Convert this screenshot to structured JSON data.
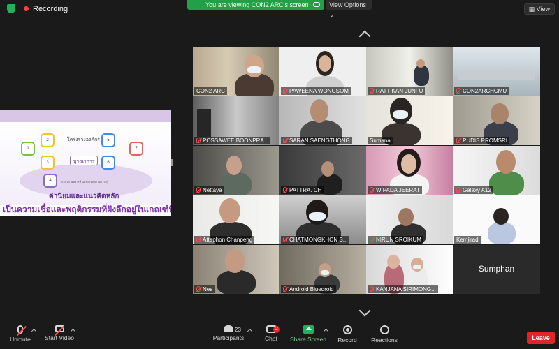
{
  "status": {
    "recording_label": "Recording"
  },
  "banner": {
    "viewing_text": "You are viewing CON2 ARC's screen",
    "view_options_label": "View Options"
  },
  "view_button": {
    "label": "View"
  },
  "shared_screen": {
    "top_hex_label": "โครงร่างองค์กร",
    "center_label": "บูรณาการ",
    "core_values_label": "ค่านิยมและแนวคิดหลัก",
    "bottom_text": "เป็นความเชื่อและพฤติกรรมที่ฝังลึกอยู่ในเกณฑ์นี้ แ",
    "hex_numbers": [
      "1",
      "2",
      "3",
      "4",
      "5",
      "6",
      "7"
    ],
    "hex_labels": [
      "การนำองค์กร",
      "กลยุทธ์",
      "ลูกค้า",
      "การวัด",
      "บุคลากร",
      "ระบบปฏิบัติการ",
      "ผลลัพธ์"
    ],
    "small_caption": "การวัด วิเคราะห์ และการจัดการความรู้"
  },
  "participants": [
    {
      "name": "CON2 ARC",
      "muted": false,
      "active": true
    },
    {
      "name": "PAWEENA WONGSOM",
      "muted": true
    },
    {
      "name": "RATTIKAN JUNFU",
      "muted": true
    },
    {
      "name": "CON2ARCHCMU",
      "muted": true
    },
    {
      "name": "POSSAWEE BOONPRA...",
      "muted": true
    },
    {
      "name": "SARAN SAENGTHONG",
      "muted": true
    },
    {
      "name": "Sumana",
      "muted": false
    },
    {
      "name": "PUDIS PROMSRI",
      "muted": true
    },
    {
      "name": "Nettaya",
      "muted": true
    },
    {
      "name": "PATTRA. CH",
      "muted": true
    },
    {
      "name": "WIPADA JEERAT",
      "muted": true
    },
    {
      "name": "Galaxy A12",
      "muted": true
    },
    {
      "name": "Attaphon Chanpeng",
      "muted": true
    },
    {
      "name": "CHATMONGKHON S...",
      "muted": true
    },
    {
      "name": "NIRUN SROIKUM",
      "muted": true
    },
    {
      "name": "Kemjirad",
      "muted": false
    },
    {
      "name": "Nes",
      "muted": true
    },
    {
      "name": "Android Bluedroid",
      "muted": true
    },
    {
      "name": "KANJANA SIRIMONG...",
      "muted": true
    },
    {
      "name": "Sumphan",
      "muted": false,
      "no_video": true
    }
  ],
  "toolbar": {
    "unmute": "Unmute",
    "start_video": "Start Video",
    "participants": "Participants",
    "participant_count": "23",
    "chat": "Chat",
    "chat_badge": "2",
    "share_screen": "Share Screen",
    "record": "Record",
    "reactions": "Reactions",
    "leave": "Leave"
  },
  "colors": {
    "accent_green": "#23a047",
    "leave_red": "#e0252a",
    "active_border": "#b4d87a"
  }
}
